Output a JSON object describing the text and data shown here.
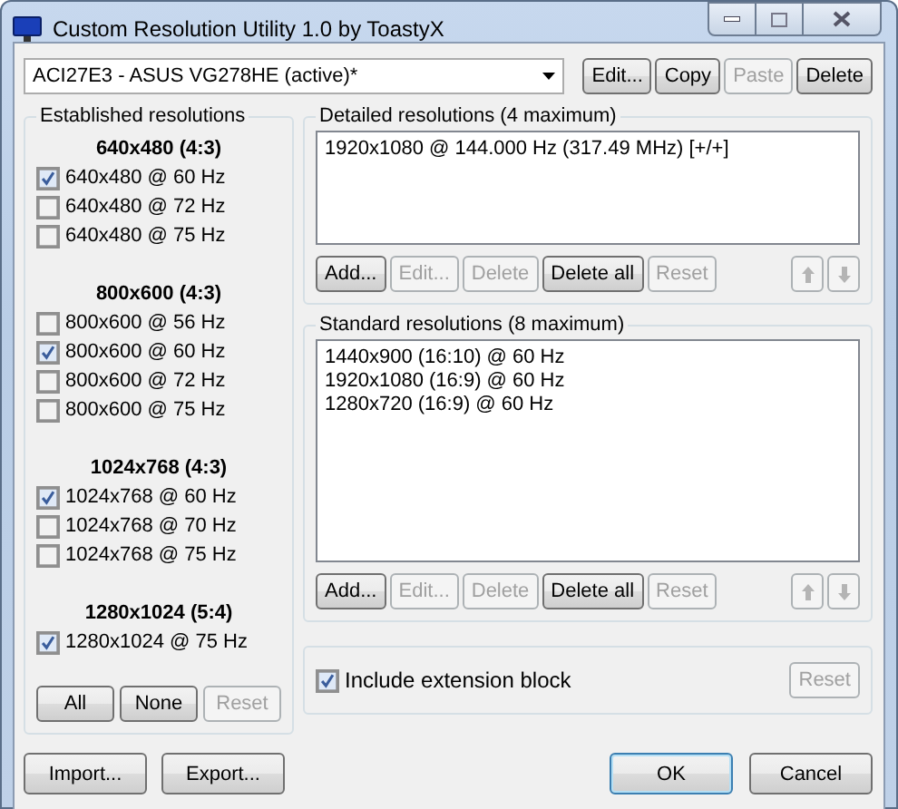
{
  "window": {
    "title": "Custom Resolution Utility 1.0 by ToastyX"
  },
  "monitor": {
    "value": "ACI27E3 - ASUS VG278HE (active)*"
  },
  "monitor_buttons": [
    {
      "label": "Edit...",
      "disabled": false
    },
    {
      "label": "Copy",
      "disabled": false
    },
    {
      "label": "Paste",
      "disabled": true
    },
    {
      "label": "Delete",
      "disabled": false
    }
  ],
  "established": {
    "title": "Established resolutions",
    "groups": [
      {
        "heading": "640x480 (4:3)",
        "items": [
          {
            "label": "640x480 @ 60 Hz",
            "checked": true
          },
          {
            "label": "640x480 @ 72 Hz",
            "checked": false
          },
          {
            "label": "640x480 @ 75 Hz",
            "checked": false
          }
        ]
      },
      {
        "heading": "800x600 (4:3)",
        "items": [
          {
            "label": "800x600 @ 56 Hz",
            "checked": false
          },
          {
            "label": "800x600 @ 60 Hz",
            "checked": true
          },
          {
            "label": "800x600 @ 72 Hz",
            "checked": false
          },
          {
            "label": "800x600 @ 75 Hz",
            "checked": false
          }
        ]
      },
      {
        "heading": "1024x768 (4:3)",
        "items": [
          {
            "label": "1024x768 @ 60 Hz",
            "checked": true
          },
          {
            "label": "1024x768 @ 70 Hz",
            "checked": false
          },
          {
            "label": "1024x768 @ 75 Hz",
            "checked": false
          }
        ]
      },
      {
        "heading": "1280x1024 (5:4)",
        "items": [
          {
            "label": "1280x1024 @ 75 Hz",
            "checked": true
          }
        ]
      }
    ],
    "buttons": [
      {
        "label": "All",
        "disabled": false
      },
      {
        "label": "None",
        "disabled": false
      },
      {
        "label": "Reset",
        "disabled": true
      }
    ]
  },
  "detailed": {
    "title": "Detailed resolutions (4 maximum)",
    "items": [
      "1920x1080 @ 144.000 Hz (317.49 MHz) [+/+]"
    ],
    "buttons": [
      {
        "label": "Add...",
        "disabled": false
      },
      {
        "label": "Edit...",
        "disabled": true
      },
      {
        "label": "Delete",
        "disabled": true
      },
      {
        "label": "Delete all",
        "disabled": false
      },
      {
        "label": "Reset",
        "disabled": true
      }
    ],
    "move_up": {
      "disabled": true
    },
    "move_down": {
      "disabled": true
    }
  },
  "standard": {
    "title": "Standard resolutions (8 maximum)",
    "items": [
      "1440x900 (16:10) @ 60 Hz",
      "1920x1080 (16:9) @ 60 Hz",
      "1280x720 (16:9) @ 60 Hz"
    ],
    "buttons": [
      {
        "label": "Add...",
        "disabled": false
      },
      {
        "label": "Edit...",
        "disabled": true
      },
      {
        "label": "Delete",
        "disabled": true
      },
      {
        "label": "Delete all",
        "disabled": false
      },
      {
        "label": "Reset",
        "disabled": true
      }
    ],
    "move_up": {
      "disabled": true
    },
    "move_down": {
      "disabled": true
    }
  },
  "extension": {
    "label": "Include extension block",
    "checked": true,
    "reset": {
      "label": "Reset",
      "disabled": true
    }
  },
  "footer": {
    "left": [
      {
        "label": "Import...",
        "default": false
      },
      {
        "label": "Export...",
        "default": false
      }
    ],
    "right": [
      {
        "label": "OK",
        "default": true
      },
      {
        "label": "Cancel",
        "default": false
      }
    ]
  }
}
